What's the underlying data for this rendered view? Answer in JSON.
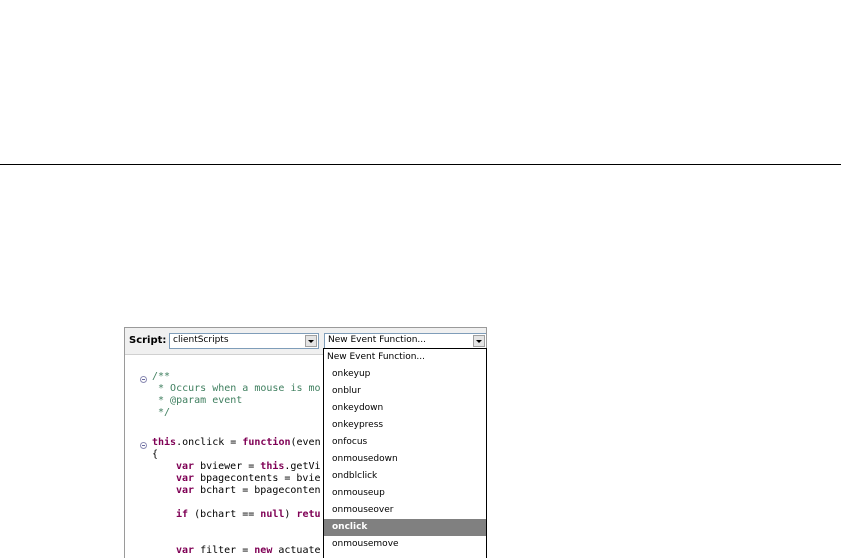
{
  "toolbar": {
    "script_label": "Script:",
    "script_combo_value": "clientScripts",
    "event_combo_value": "New Event Function..."
  },
  "editor": {
    "comment_open": "/**",
    "comment_line1": " * Occurs when a mouse is mo",
    "comment_line2": " * @param event",
    "comment_close": " */",
    "fn_this": "this",
    "fn_mid": ".onclick = ",
    "fn_function": "function",
    "fn_tail": "(even",
    "open_brace": "{",
    "var1_kw": "var",
    "var1_mid": " bviewer = ",
    "var1_this": "this",
    "var1_tail": ".getVi",
    "var2_kw": "var",
    "var2_tail": " bpagecontents = bvie",
    "var3_kw": "var",
    "var3_tail": " bchart = bpageconten",
    "if_kw": "if",
    "if_mid": " (bchart == ",
    "if_null": "null",
    "if_mid2": ") ",
    "if_ret": "retu",
    "var4_kw": "var",
    "var4_mid": " filter = ",
    "var4_new": "new",
    "var4_tail": " actuate"
  },
  "dropdown": {
    "items": [
      "New Event Function...",
      "onkeyup",
      "onblur",
      "onkeydown",
      "onkeypress",
      "onfocus",
      "onmousedown",
      "ondblclick",
      "onmouseup",
      "onmouseover",
      "onclick",
      "onmousemove"
    ],
    "selected": "onclick"
  }
}
